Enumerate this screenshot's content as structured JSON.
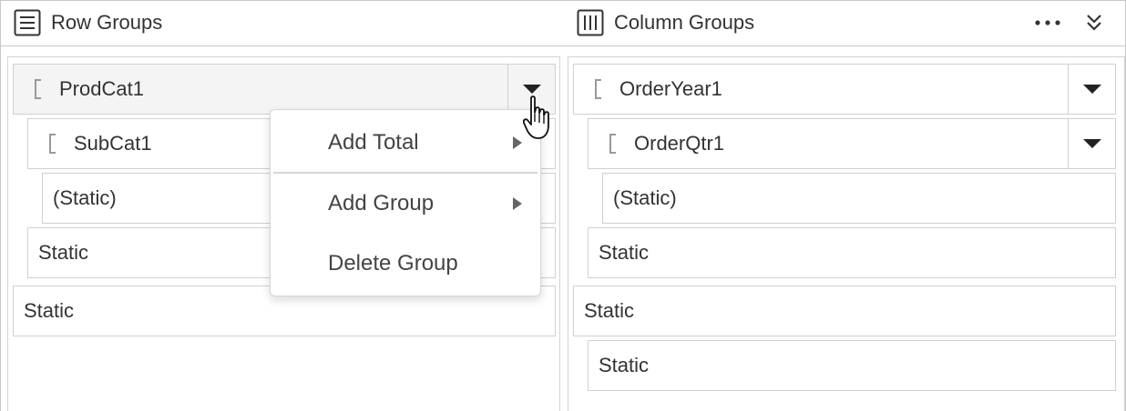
{
  "header": {
    "row_groups_label": "Row Groups",
    "column_groups_label": "Column Groups",
    "more_icon": "more-horizontal-icon",
    "collapse_icon": "double-chevron-down-icon"
  },
  "row_groups": {
    "prodcat": "ProdCat1",
    "subcat": "SubCat1",
    "static_inner": "(Static)",
    "static_mid": "Static",
    "static_outer": "Static"
  },
  "column_groups": {
    "orderyear": "OrderYear1",
    "orderqtr": "OrderQtr1",
    "static_inner": "(Static)",
    "static_mid": "Static",
    "static_outer": "Static",
    "static_last": "Static"
  },
  "context_menu": {
    "add_total": "Add Total",
    "add_group": "Add Group",
    "delete_group": "Delete Group"
  }
}
